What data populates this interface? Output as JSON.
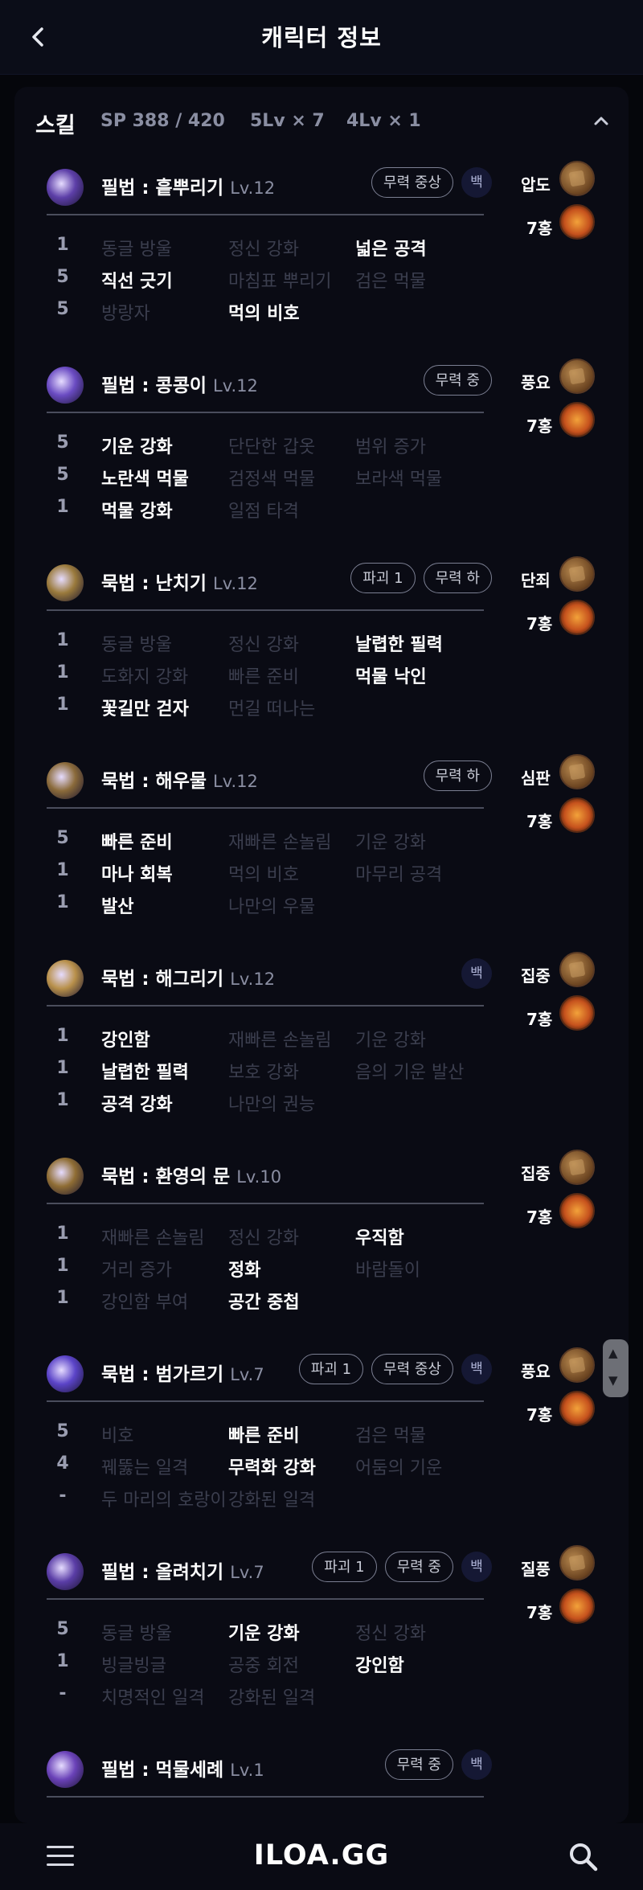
{
  "header": {
    "title": "캐릭터 정보",
    "back_icon": "chevron-left-icon"
  },
  "skills_panel": {
    "title": "스킬",
    "sp": "SP 388 / 420",
    "lv5": "5Lv × 7",
    "lv4": "4Lv × 1",
    "collapse_icon": "chevron-up-icon"
  },
  "skills": [
    {
      "name": "필법 : 흩뿌리기",
      "level": "Lv.12",
      "tags": [
        "무력 중상"
      ],
      "gem": "백",
      "icon_color": "#5d3fa8",
      "rows": [
        {
          "n": "1",
          "t": [
            "동글 방울",
            "정신 강화",
            "넓은 공격"
          ],
          "on": 2
        },
        {
          "n": "5",
          "t": [
            "직선 긋기",
            "마침표 뿌리기",
            "검은 먹물"
          ],
          "on": 0
        },
        {
          "n": "5",
          "t": [
            "방랑자",
            "먹의 비호",
            ""
          ],
          "on": 1
        }
      ],
      "rune": "압도",
      "jewel": "7홍"
    },
    {
      "name": "필법 : 콩콩이",
      "level": "Lv.12",
      "tags": [
        "무력 중"
      ],
      "gem": "",
      "icon_color": "#6a4bc2",
      "rows": [
        {
          "n": "5",
          "t": [
            "기운 강화",
            "단단한 갑옷",
            "범위 증가"
          ],
          "on": 0
        },
        {
          "n": "5",
          "t": [
            "노란색 먹물",
            "검정색 먹물",
            "보라색 먹물"
          ],
          "on": 0
        },
        {
          "n": "1",
          "t": [
            "먹물 강화",
            "일점 타격",
            ""
          ],
          "on": 0
        }
      ],
      "rune": "풍요",
      "jewel": "7홍"
    },
    {
      "name": "묵법 : 난치기",
      "level": "Lv.12",
      "tags": [
        "파괴 1",
        "무력 하"
      ],
      "gem": "",
      "icon_color": "#9a7a3c",
      "rows": [
        {
          "n": "1",
          "t": [
            "동글 방울",
            "정신 강화",
            "날렵한 필력"
          ],
          "on": 2
        },
        {
          "n": "1",
          "t": [
            "도화지 강화",
            "빠른 준비",
            "먹물 낙인"
          ],
          "on": 2
        },
        {
          "n": "1",
          "t": [
            "꽃길만 걷자",
            "먼길 떠나는",
            ""
          ],
          "on": 0
        }
      ],
      "rune": "단죄",
      "jewel": "7홍"
    },
    {
      "name": "묵법 : 해우물",
      "level": "Lv.12",
      "tags": [
        "무력 하"
      ],
      "gem": "",
      "icon_color": "#8a6a3a",
      "rows": [
        {
          "n": "5",
          "t": [
            "빠른 준비",
            "재빠른 손놀림",
            "기운 강화"
          ],
          "on": 0
        },
        {
          "n": "1",
          "t": [
            "마나 회복",
            "먹의 비호",
            "마무리 공격"
          ],
          "on": 0
        },
        {
          "n": "1",
          "t": [
            "발산",
            "나만의 우물",
            ""
          ],
          "on": 0
        }
      ],
      "rune": "심판",
      "jewel": "7홍"
    },
    {
      "name": "묵법 : 해그리기",
      "level": "Lv.12",
      "tags": [],
      "gem": "백",
      "icon_color": "#b8904a",
      "rows": [
        {
          "n": "1",
          "t": [
            "강인함",
            "재빠른 손놀림",
            "기운 강화"
          ],
          "on": 0
        },
        {
          "n": "1",
          "t": [
            "날렵한 필력",
            "보호 강화",
            "음의 기운 발산"
          ],
          "on": 0
        },
        {
          "n": "1",
          "t": [
            "공격 강화",
            "나만의 권능",
            ""
          ],
          "on": 0
        }
      ],
      "rune": "집중",
      "jewel": "7홍"
    },
    {
      "name": "묵법 : 환영의 문",
      "level": "Lv.10",
      "tags": [],
      "gem": "",
      "icon_color": "#8f6d34",
      "rows": [
        {
          "n": "1",
          "t": [
            "재빠른 손놀림",
            "정신 강화",
            "우직함"
          ],
          "on": 2
        },
        {
          "n": "1",
          "t": [
            "거리 증가",
            "정화",
            "바람돌이"
          ],
          "on": 1
        },
        {
          "n": "1",
          "t": [
            "강인함 부여",
            "공간 중첩",
            ""
          ],
          "on": 1
        }
      ],
      "rune": "집중",
      "jewel": "7홍"
    },
    {
      "name": "묵법 : 범가르기",
      "level": "Lv.7",
      "tags": [
        "파괴 1",
        "무력 중상"
      ],
      "gem": "백",
      "icon_color": "#5b44c8",
      "rows": [
        {
          "n": "5",
          "t": [
            "비호",
            "빠른 준비",
            "검은 먹물"
          ],
          "on": 1
        },
        {
          "n": "4",
          "t": [
            "꿰뚫는 일격",
            "무력화 강화",
            "어둠의 기운"
          ],
          "on": 1
        },
        {
          "n": "-",
          "t": [
            "두 마리의 호랑이",
            "강화된 일격",
            ""
          ],
          "on": -1
        }
      ],
      "rune": "풍요",
      "jewel": "7홍"
    },
    {
      "name": "필법 : 올려치기",
      "level": "Lv.7",
      "tags": [
        "파괴 1",
        "무력 중"
      ],
      "gem": "백",
      "icon_color": "#5a3da6",
      "rows": [
        {
          "n": "5",
          "t": [
            "동글 방울",
            "기운 강화",
            "정신 강화"
          ],
          "on": 1
        },
        {
          "n": "1",
          "t": [
            "빙글빙글",
            "공중 회전",
            "강인함"
          ],
          "on": 2
        },
        {
          "n": "-",
          "t": [
            "치명적인 일격",
            "강화된 일격",
            ""
          ],
          "on": -1
        }
      ],
      "rune": "질풍",
      "jewel": "7홍"
    },
    {
      "name": "필법 : 먹물세례",
      "level": "Lv.1",
      "tags": [
        "무력 중"
      ],
      "gem": "백",
      "icon_color": "#6a42b8",
      "rows": [],
      "rune": "",
      "jewel": ""
    }
  ],
  "footer": {
    "logo": "ILOA.GG",
    "menu_icon": "hamburger-menu-icon",
    "search_icon": "search-icon"
  }
}
